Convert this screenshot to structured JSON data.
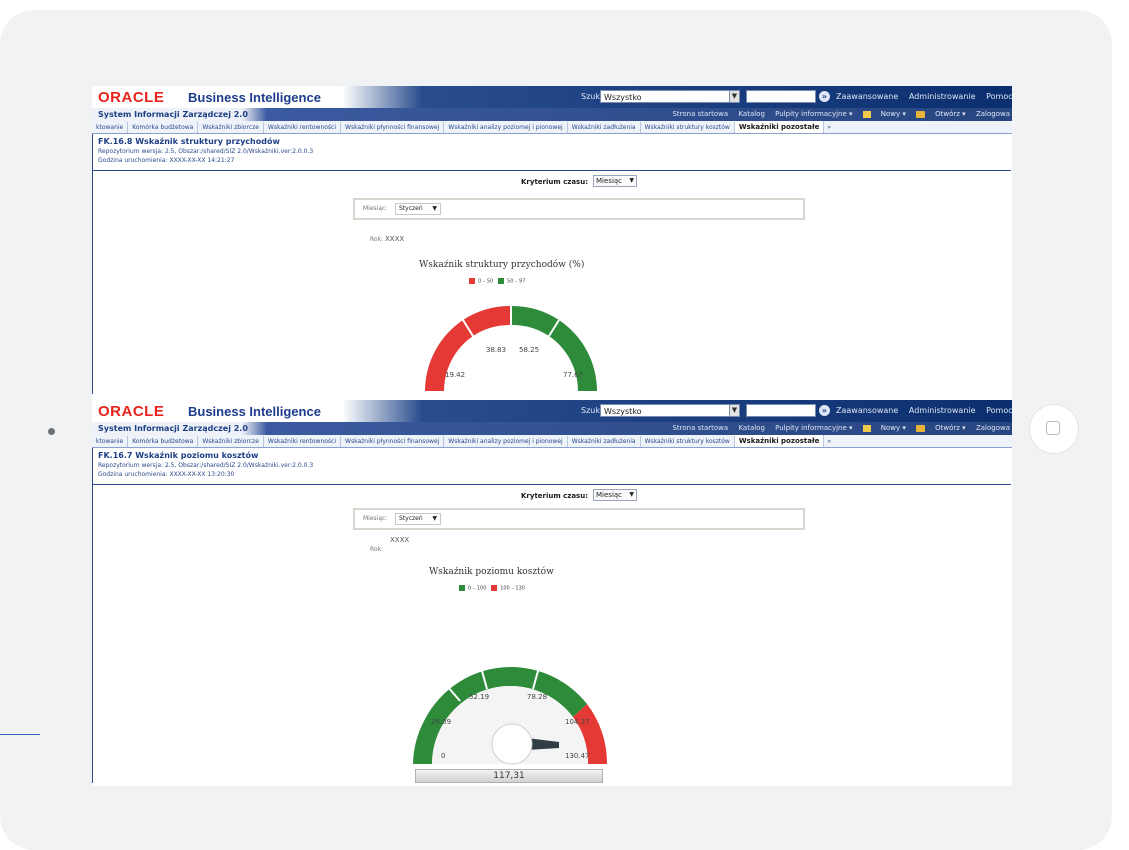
{
  "app": {
    "brand": "ORACLE",
    "product": "Business Intelligence",
    "search_label": "Szukaj",
    "search_scope": "Wszystko",
    "top_links": [
      "Zaawansowane",
      "Administrowanie",
      "Pomoc ▾"
    ],
    "system_name": "System Informacji Zarządczej 2.0",
    "nav_links": [
      "Strona startowa",
      "Katalog",
      "Pulpity informacyjne ▾",
      "Nowy ▾",
      "Otwórz ▾",
      "Zalogowa"
    ],
    "colors": {
      "oracle_red": "#e8231b",
      "header_blue": "#0a2e6e",
      "gauge_red": "#e53935",
      "gauge_green": "#2e8b3a"
    }
  },
  "tabs": [
    "ktowanie",
    "Komórka budżetowa",
    "Wskaźniki zbiorcze",
    "Wskaźniki rentowności",
    "Wskaźniki płynności finansowej",
    "Wskaźniki analizy poziomej i pionowej",
    "Wskaźniki zadłużenia",
    "Wskaźniki struktury kosztów",
    "Wskaźniki pozostałe",
    "»"
  ],
  "windows": [
    {
      "report_title": "FK.16.8 Wskaźnik struktury przychodów",
      "repo": "Repozytorium wersja: 2.5, Obszar:/shared/SIZ 2.0/Wskaźniki.ver:2.0.0.3",
      "run_time": "Godzina uruchomienia: XXXX-XX-XX 14:21:27",
      "criterion_label": "Kryterium czasu:",
      "criterion_value": "Miesiąc",
      "month_label": "Miesiąc:",
      "month_value": "Styczeń",
      "year_label": "Rok:",
      "year_value": "XXXX",
      "gauge_title": "Wskaźnik struktury przychodów (%)",
      "legend": [
        {
          "label": "0 – 50",
          "color": "#e53935"
        },
        {
          "label": "50 – 97",
          "color": "#2e8b3a"
        }
      ],
      "ticks": [
        "19.42",
        "38.83",
        "58.25",
        "77.67"
      ]
    },
    {
      "report_title": "FK.16.7 Wskaźnik poziomu kosztów",
      "repo": "Repozytorium wersja: 2.5, Obszar:/shared/SIZ 2.0/Wskaźniki.ver:2.0.0.3",
      "run_time": "Godzina uruchomienia: XXXX-XX-XX 13:20:30",
      "criterion_label": "Kryterium czasu:",
      "criterion_value": "Miesiąc",
      "month_label": "Miesiąc:",
      "month_value": "Styczeń",
      "year_label": "Rok:",
      "year_value": "XXXX",
      "gauge_title": "Wskaźnik poziomu kosztów",
      "legend": [
        {
          "label": "0 – 100",
          "color": "#2e8b3a"
        },
        {
          "label": "100 – 130",
          "color": "#e53935"
        }
      ],
      "ticks": [
        "0",
        "26.09",
        "52.19",
        "78.28",
        "104.37",
        "130.47"
      ],
      "value": "117,31"
    }
  ]
}
